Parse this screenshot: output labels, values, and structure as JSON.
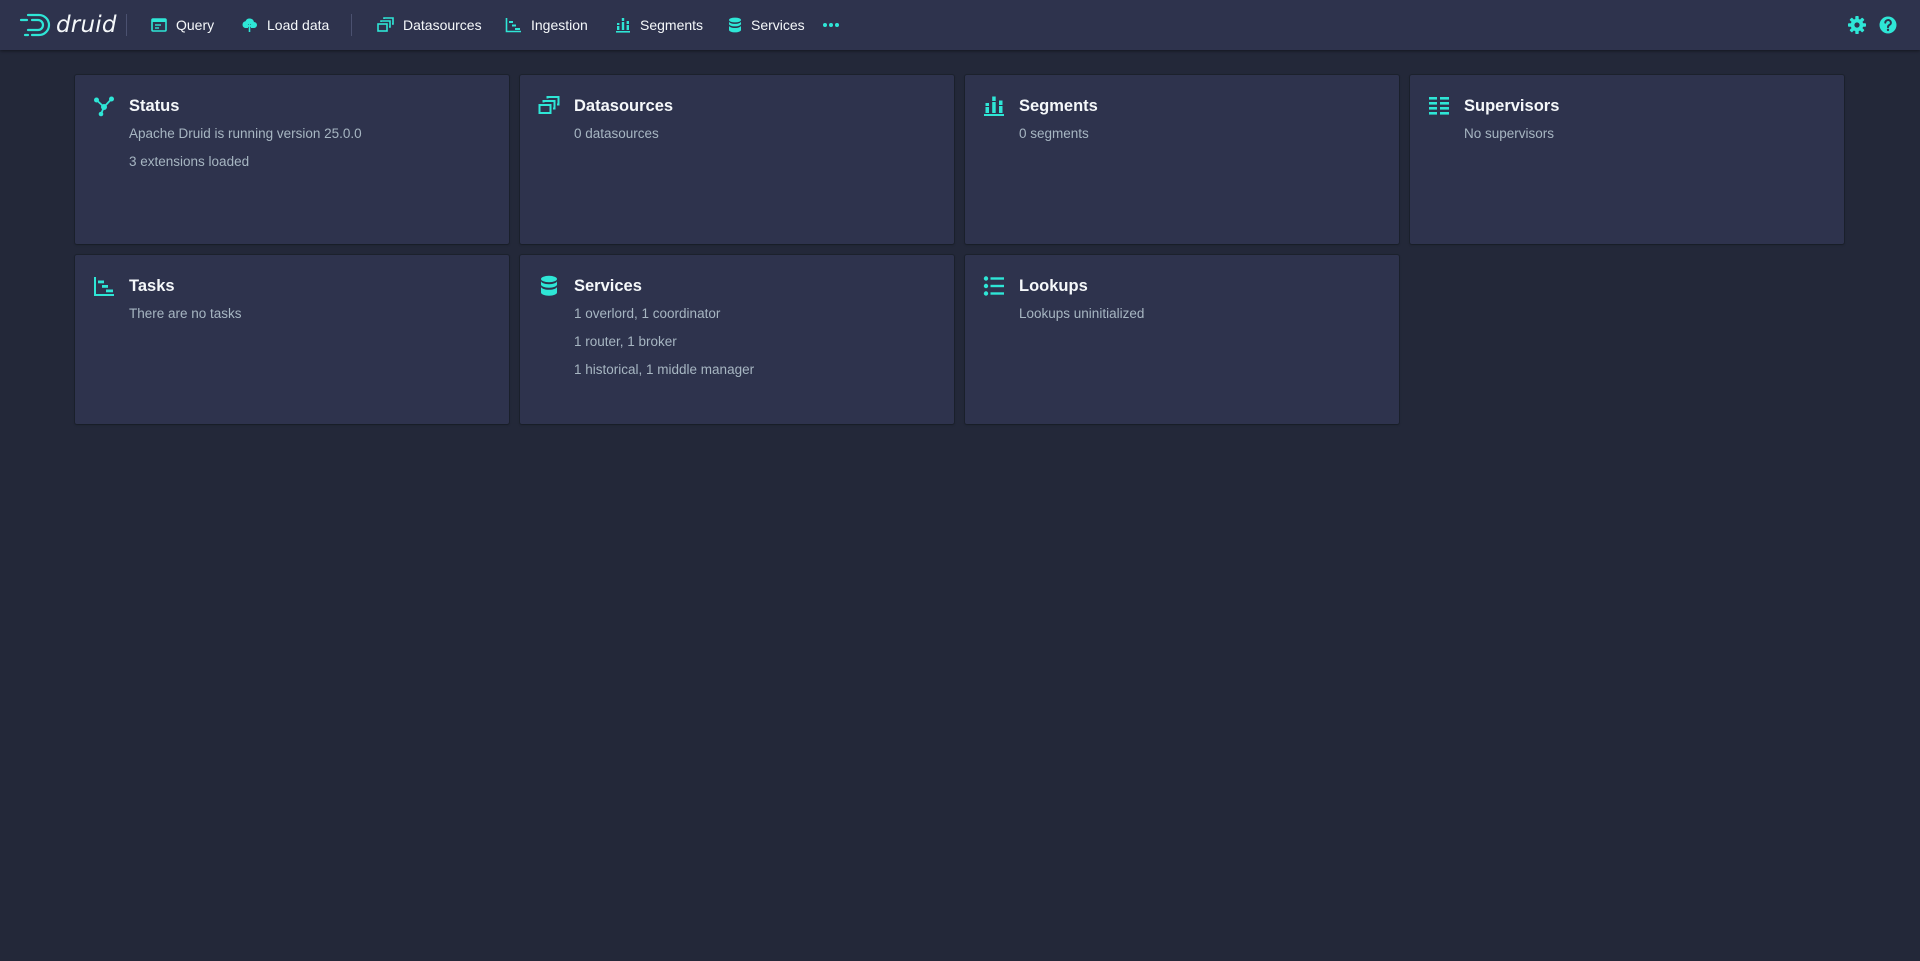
{
  "header": {
    "logo_text": "druid",
    "nav": [
      {
        "label": "Query",
        "icon": "application-icon"
      },
      {
        "label": "Load data",
        "icon": "cloud-upload-icon"
      },
      {
        "label": "Datasources",
        "icon": "multi-select-icon"
      },
      {
        "label": "Ingestion",
        "icon": "gantt-chart-icon"
      },
      {
        "label": "Segments",
        "icon": "stacked-chart-icon"
      },
      {
        "label": "Services",
        "icon": "database-icon"
      }
    ],
    "more_icon": "more-icon",
    "settings_icon": "cog-icon",
    "help_icon": "help-icon"
  },
  "cards": [
    {
      "title": "Status",
      "icon": "graph-icon",
      "lines": [
        "Apache Druid is running version 25.0.0",
        "3 extensions loaded"
      ]
    },
    {
      "title": "Datasources",
      "icon": "multi-select-icon",
      "lines": [
        "0 datasources"
      ]
    },
    {
      "title": "Segments",
      "icon": "stacked-chart-icon",
      "lines": [
        "0 segments"
      ]
    },
    {
      "title": "Supervisors",
      "icon": "list-columns-icon",
      "lines": [
        "No supervisors"
      ]
    },
    {
      "title": "Tasks",
      "icon": "gantt-chart-icon",
      "lines": [
        "There are no tasks"
      ]
    },
    {
      "title": "Services",
      "icon": "database-icon",
      "lines": [
        "1 overlord, 1 coordinator",
        "1 router, 1 broker",
        "1 historical, 1 middle manager"
      ]
    },
    {
      "title": "Lookups",
      "icon": "properties-icon",
      "lines": [
        "Lookups uninitialized"
      ]
    }
  ],
  "colors": {
    "background": "#232839",
    "surface": "#2e334d",
    "accent": "#2ee6d6",
    "text": "#f5f8fa",
    "muted": "#a7b6c2"
  }
}
